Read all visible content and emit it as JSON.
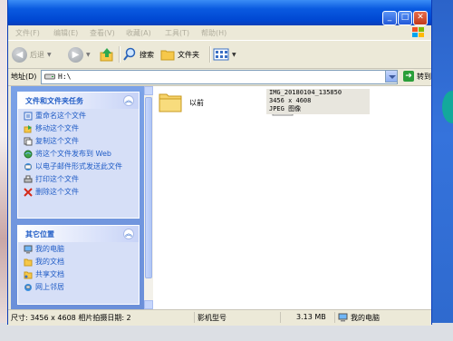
{
  "menu": [
    "文件(F)",
    "编辑(E)",
    "查看(V)",
    "收藏(A)",
    "工具(T)",
    "帮助(H)"
  ],
  "toolbar": {
    "back": "后退",
    "search": "搜索",
    "folders": "文件夹"
  },
  "address": {
    "label": "地址(D)",
    "value": "H:\\",
    "go": "转到"
  },
  "tasks_panel": {
    "title": "文件和文件夹任务",
    "items": [
      {
        "label": "重命名这个文件",
        "icon": "rename-icon"
      },
      {
        "label": "移动这个文件",
        "icon": "move-icon"
      },
      {
        "label": "复制这个文件",
        "icon": "copy-icon"
      },
      {
        "label": "将这个文件发布到 Web",
        "icon": "web-publish-icon"
      },
      {
        "label": "以电子邮件形式发送此文件",
        "icon": "email-icon"
      },
      {
        "label": "打印这个文件",
        "icon": "print-icon"
      },
      {
        "label": "删除这个文件",
        "icon": "delete-icon"
      }
    ]
  },
  "places_panel": {
    "title": "其它位置",
    "items": [
      {
        "label": "我的电脑",
        "icon": "my-computer-icon"
      },
      {
        "label": "我的文档",
        "icon": "my-documents-icon"
      },
      {
        "label": "共享文档",
        "icon": "shared-documents-icon"
      },
      {
        "label": "网上邻居",
        "icon": "network-icon"
      }
    ]
  },
  "files": [
    {
      "name": "以前",
      "type": "folder"
    },
    {
      "name": "IMG_20180104_135850",
      "dimensions": "3456 x 4608",
      "kind": "JPEG 图像"
    }
  ],
  "status": {
    "info": "尺寸: 3456 x 4608 相片拍摄日期: 2",
    "camera": "影机型号",
    "size": "3.13 MB",
    "location": "我的电脑"
  }
}
